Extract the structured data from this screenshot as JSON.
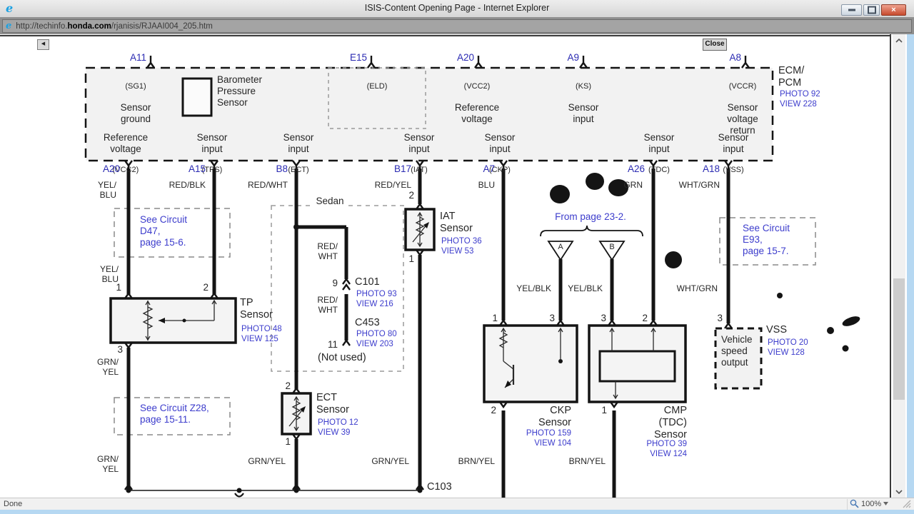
{
  "window": {
    "title": "ISIS-Content Opening Page - Internet Explorer"
  },
  "address_bar": {
    "prefix": "http://techinfo.",
    "domain": "honda.com",
    "path": "/rjanisis/RJAAI004_205.htm"
  },
  "toolbar": {
    "back": "◀",
    "close": "Close"
  },
  "status_bar": {
    "text": "Done",
    "zoom": "100%"
  },
  "colors": {
    "pin_blue": "#2a2ab2",
    "link_blue": "#3c3ccc",
    "frame_blue": "#b6d8f2",
    "wire": "#141414"
  },
  "diagram": {
    "ecm": {
      "pins_top": [
        "A11",
        "E15",
        "A20",
        "A9",
        "A8"
      ],
      "cells_top": [
        {
          "code": "(SG1)",
          "label": "Sensor\nground"
        },
        {
          "code": "(ELD)",
          "label": ""
        },
        {
          "code": "(VCC2)",
          "label": "Reference\nvoltage"
        },
        {
          "code": "(KS)",
          "label": "Sensor\ninput"
        },
        {
          "code": "(VCCR)",
          "label": "Sensor\nvoltage\nreturn"
        }
      ],
      "barometer_label": "Barometer\nPressure\nSensor",
      "cells_bottom": [
        {
          "label": "Reference\nvoltage",
          "code": "(VCC2)"
        },
        {
          "label": "Sensor\ninput",
          "code": "(TPS)"
        },
        {
          "label": "Sensor\ninput",
          "code": "(ECT)"
        },
        {
          "label": "Sensor\ninput",
          "code": "(IAT)"
        },
        {
          "label": "Sensor\ninput",
          "code": "(CKP)"
        },
        {
          "label": "Sensor\ninput",
          "code": "(TDC)"
        },
        {
          "label": "Sensor\ninput",
          "code": "(VSS)"
        }
      ],
      "pins_bottom": [
        "A20",
        "A15",
        "B8",
        "B17",
        "A7",
        "A26",
        "A18"
      ],
      "name": "ECM/\nPCM",
      "photo": "PHOTO 92",
      "view": "VIEW 228"
    },
    "wire_labels": {
      "a20_1": "YEL/\nBLU",
      "a15": "RED/BLK",
      "b8": "RED/WHT",
      "b17": "RED/YEL",
      "a7": "BLU",
      "a26": "GRN",
      "a18": "WHT/GRN",
      "a20_2": "YEL/\nBLU",
      "tp3": "GRN/\nYEL",
      "left_bottom": "GRN/\nYEL",
      "sedan_1": "RED/\nWHT",
      "sedan_2": "RED/\nWHT",
      "ect_bottom": "GRN/YEL",
      "iat_bottom": "GRN/YEL",
      "tri_a": "YEL/BLK",
      "tri_b": "YEL/BLK",
      "vss": "WHT/GRN",
      "ckp_bottom": "BRN/YEL",
      "cmp_bottom": "BRN/YEL"
    },
    "refs": {
      "d47": "See Circuit\nD47,\npage 15-6.",
      "z28": "See Circuit Z28,\npage 15-11.",
      "e93": "See Circuit\nE93,\npage 15-7.",
      "from_page": "From page 23-2."
    },
    "sensors": {
      "tp": {
        "name": "TP\nSensor",
        "photo": "PHOTO 48",
        "view": "VIEW 125",
        "pin1": "1",
        "pin2": "2",
        "pin3": "3"
      },
      "iat": {
        "name": "IAT\nSensor",
        "photo": "PHOTO 36",
        "view": "VIEW 53",
        "pin_top": "2",
        "pin_bottom": "1"
      },
      "ect": {
        "name": "ECT\nSensor",
        "photo": "PHOTO 12",
        "view": "VIEW 39",
        "pin_top": "2",
        "pin_bottom": "1"
      },
      "ckp": {
        "name": "CKP\nSensor",
        "photo": "PHOTO 159",
        "view": "VIEW 104",
        "pin_l": "1",
        "pin_r": "3",
        "pin_bottom": "2"
      },
      "cmp": {
        "name": "CMP\n(TDC)\nSensor",
        "photo": "PHOTO 39",
        "view": "VIEW 124",
        "pin_l": "3",
        "pin_r": "2",
        "pin_bottom": "1"
      },
      "vss": {
        "name": "VSS",
        "photo": "PHOTO 20",
        "view": "VIEW 128",
        "pin": "3",
        "box_label": "Vehicle\nspeed\noutput"
      }
    },
    "connectors": {
      "sedan": "Sedan",
      "c101": {
        "pin": "9",
        "name": "C101",
        "photo": "PHOTO 93",
        "view": "VIEW 216"
      },
      "c453": {
        "pin": "11",
        "name": "C453",
        "photo": "PHOTO 80",
        "view": "VIEW 203",
        "note": "(Not used)"
      },
      "c103": "C103",
      "tri_a": "A",
      "tri_b": "B"
    }
  }
}
